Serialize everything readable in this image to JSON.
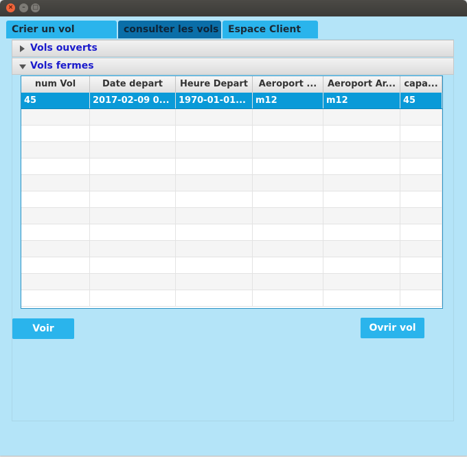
{
  "titlebar": {
    "buttons": [
      {
        "name": "close",
        "glyph": "×"
      },
      {
        "name": "minimize",
        "glyph": "–"
      },
      {
        "name": "maximize",
        "glyph": "□"
      }
    ]
  },
  "tabs": [
    {
      "label": "Crier un vol",
      "active": false
    },
    {
      "label": "consulter les vols",
      "active": true
    },
    {
      "label": "Espace Client",
      "active": false
    }
  ],
  "accordion": {
    "open_flights": {
      "label": "Vols ouverts",
      "expanded": false
    },
    "closed_flights": {
      "label": "Vols fermes",
      "expanded": true
    }
  },
  "table": {
    "columns": [
      "num Vol",
      "Date depart",
      "Heure Depart",
      "Aeroport ...",
      "Aeroport Ar...",
      "capa..."
    ],
    "rows": [
      [
        "45",
        "2017-02-09 0...",
        "1970-01-01...",
        "m12",
        "m12",
        "45"
      ]
    ],
    "selected_row": 0,
    "empty_rows": 12
  },
  "buttons": {
    "voir": "Voir",
    "ovrir_vol": "Ovrir vol"
  },
  "colors": {
    "background": "#b4e4f8",
    "accent": "#2ab4ec",
    "active_tab": "#0a6ea8",
    "selection": "#0a9ad8",
    "accordion_text": "#1a1acc"
  }
}
